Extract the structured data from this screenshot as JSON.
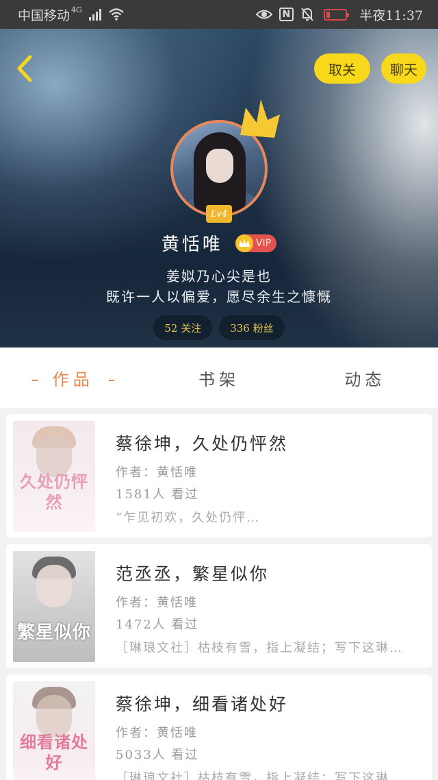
{
  "status_bar": {
    "carrier": "中国移动",
    "network": "4G",
    "time_label": "半夜11:37",
    "nfc": "N"
  },
  "header": {
    "unfollow_label": "取关",
    "chat_label": "聊天",
    "level": "Lv4",
    "username": "黄恬唯",
    "vip_label": "VIP",
    "bio_line1": "姜姒乃心尖是也",
    "bio_line2": "既许一人以偏爱，愿尽余生之慷慨",
    "following": "52 关注",
    "fans": "336 粉丝"
  },
  "tabs": [
    {
      "label": "作品",
      "active": true
    },
    {
      "label": "书架",
      "active": false
    },
    {
      "label": "动态",
      "active": false
    }
  ],
  "books": [
    {
      "title": "蔡徐坤，久处仍怦然",
      "author": "作者：黄恬唯",
      "views": "1581人 看过",
      "desc": "“乍见初欢，久处仍怦…",
      "cover_text": "久处仍怦然"
    },
    {
      "title": "范丞丞，繁星似你",
      "author": "作者：黄恬唯",
      "views": "1472人 看过",
      "desc": "［琳琅文社］枯枝有雪，指上凝结；写下这琳…",
      "cover_text": "繁星似你"
    },
    {
      "title": "蔡徐坤，细看诸处好",
      "author": "作者：黄恬唯",
      "views": "5033人 看过",
      "desc": "［琳琅文社］枯枝有雪，指上凝结；写下这琳…",
      "cover_text": "细看诸处好"
    }
  ],
  "colors": {
    "accent_yellow": "#f8d81a",
    "tab_active": "#e8894f",
    "avatar_ring": "#e8875a"
  }
}
